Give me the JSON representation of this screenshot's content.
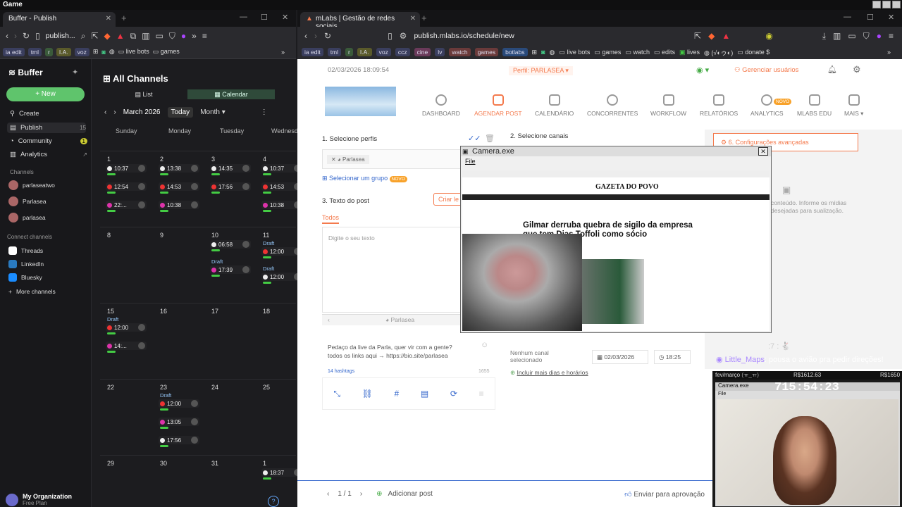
{
  "os": {
    "title": "Game"
  },
  "left_browser": {
    "tab_title": "Buffer - Publish",
    "url": "publish...",
    "bookmarks": [
      "ia edit",
      "tml",
      "r",
      "I.A.",
      "voz"
    ],
    "bookmark_folders": [
      "live bots",
      "games"
    ],
    "sidebar": {
      "brand": "Buffer",
      "new_label": "+ New",
      "nav": [
        {
          "label": "Create",
          "count": ""
        },
        {
          "label": "Publish",
          "count": "15"
        },
        {
          "label": "Community",
          "count": "1"
        },
        {
          "label": "Analytics",
          "count": ""
        }
      ],
      "channels_header": "Channels",
      "channels": [
        "parlaseatwo",
        "Parlasea",
        "parlasea"
      ],
      "connect_header": "Connect channels",
      "connect": [
        "Threads",
        "LinkedIn",
        "Bluesky",
        "More channels"
      ],
      "org_name": "My Organization",
      "org_plan": "Free Plan"
    },
    "calendar": {
      "title": "All Channels",
      "view_list": "List",
      "view_calendar": "Calendar",
      "month": "March 2026",
      "today": "Today",
      "mode": "Month",
      "days": [
        "Sunday",
        "Monday",
        "Tuesday",
        "Wednesday"
      ],
      "weeks": [
        [
          {
            "d": "1",
            "ev": [
              "10:37",
              "12:54",
              "22:..."
            ]
          },
          {
            "d": "2",
            "ev": [
              "13:38",
              "14:53",
              "10:38"
            ]
          },
          {
            "d": "3",
            "ev": [
              "14:35",
              "17:56"
            ]
          },
          {
            "d": "4",
            "ev": [
              "10:37",
              "14:53",
              "10:38"
            ]
          }
        ],
        [
          {
            "d": "8",
            "ev": []
          },
          {
            "d": "9",
            "ev": []
          },
          {
            "d": "10",
            "ev": [
              "06:58",
              "Draft",
              "17:39"
            ]
          },
          {
            "d": "11",
            "ev": [
              "Draft",
              "12:00",
              "Draft",
              "12:00"
            ]
          }
        ],
        [
          {
            "d": "15",
            "ev": [
              "Draft",
              "12:00",
              "14:..."
            ]
          },
          {
            "d": "16",
            "ev": []
          },
          {
            "d": "17",
            "ev": []
          },
          {
            "d": "18",
            "ev": []
          }
        ],
        [
          {
            "d": "22",
            "ev": []
          },
          {
            "d": "23",
            "ev": [
              "Draft",
              "12:00",
              "13:05",
              "17:56"
            ]
          },
          {
            "d": "24",
            "ev": []
          },
          {
            "d": "25",
            "ev": []
          }
        ],
        [
          {
            "d": "29",
            "ev": []
          },
          {
            "d": "30",
            "ev": []
          },
          {
            "d": "31",
            "ev": []
          },
          {
            "d": "1",
            "ev": [
              "18:37"
            ]
          }
        ]
      ]
    }
  },
  "right_browser": {
    "tab_title": "mLabs | Gestão de redes sociais",
    "url": "publish.mlabs.io/schedule/new",
    "bookmarks": [
      "ia edit",
      "tml",
      "r",
      "I.A.",
      "voz",
      "ccz",
      "cine",
      "lv",
      "watch",
      "games",
      "botlabs"
    ],
    "bookmark_folders": [
      "live bots",
      "games",
      "watch",
      "edits",
      "lives",
      "(√◐ゥ◐)",
      "donate $"
    ],
    "date": "02/03/2026 18:09:54",
    "perfil": "Perfil: PARLASEA",
    "gerenciar": "Gerenciar usuários",
    "menu": [
      "DASHBOARD",
      "AGENDAR POST",
      "CALENDÁRIO",
      "CONCORRENTES",
      "WORKFLOW",
      "RELATÓRIOS",
      "ANALYTICS",
      "MLABS EDU",
      "MAIS ▾"
    ],
    "novo": "NOVO",
    "step1": "1. Selecione perfis",
    "profile_chip": "Parlasea",
    "select_group": "Selecionar um grupo",
    "step2": "2. Selecione canais",
    "step3": "3. Texto do post",
    "criar": "Criar le",
    "todos": "Todos",
    "placeholder": "Digite o seu texto",
    "preview_name": "Parlasea",
    "post_line1": "Pedaço da live da Parla, quer vir com a gente?",
    "post_line2": "todos os links aqui → https://bio.site/parlasea",
    "hashtags": "14 hashtags",
    "charcount": "1655",
    "advanced": "6. Configurações avançadas",
    "no_channel": "Nenhum canal selecionado",
    "sched_date": "02/03/2026",
    "sched_time": "18:25",
    "more_days": "Incluir mais dias e horários",
    "side_note": "conteúdo. Informe os mídias desejadas para sualização.",
    "pager": "1 / 1",
    "add_post": "Adicionar post",
    "send_approval": "Enviar para aprovação"
  },
  "camera_window": {
    "title": "Camera.exe",
    "menu": "File",
    "site": "GAZETA DO POVO",
    "headline": "Gilmar derruba quebra de sigilo da empresa que tem Dias Toffoli como sócio"
  },
  "overlay": {
    "chat_user": "Little_Maps",
    "chat_msg": ": pousa o avião pra pedir direções!",
    "label": "fev/março",
    "amount1": "R$1612.63",
    "amount2": "R$1650",
    "cam_title": "Camera.exe",
    "cam_menu": "File",
    "timer": "715:54:23"
  }
}
